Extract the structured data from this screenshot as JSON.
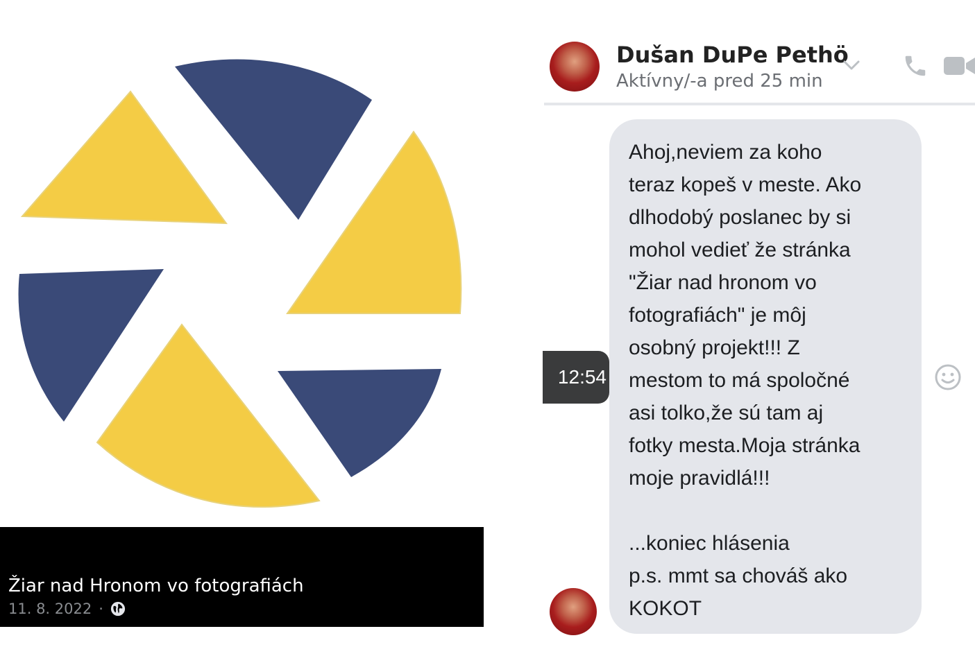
{
  "post": {
    "title": "Žiar nad Hronom vo fotografiách",
    "date": "11. 8. 2022",
    "separator": "·",
    "privacy_icon": "globe-icon"
  },
  "logo": {
    "colors": {
      "yellow": "#f4cc45",
      "navy": "#3a4a78"
    }
  },
  "chat": {
    "contact_name": "Dušan DuPe Pethö",
    "status": "Aktívny/-a pred 25 min",
    "header_icons": [
      "chevron-down-icon",
      "phone-icon",
      "video-icon"
    ],
    "timestamp": "12:54",
    "message": "Ahoj,neviem za koho\nteraz kopeš v meste. Ako\ndlhodobý poslanec by si\nmohol vedieť že stránka\n\"Žiar nad hronom vo\nfotografiách\" je môj\nosobný projekt!!! Z\nmestom to má spoločné\nasi tolko,že sú tam aj\nfotky mesta.Moja stránka\nmoje pravidlá!!!\n\n...koniec hlásenia\np.s. mmt sa chováš ako\nKOKOT",
    "reaction_icon": "smiley-icon",
    "bubble_color": "#e4e6eb"
  }
}
